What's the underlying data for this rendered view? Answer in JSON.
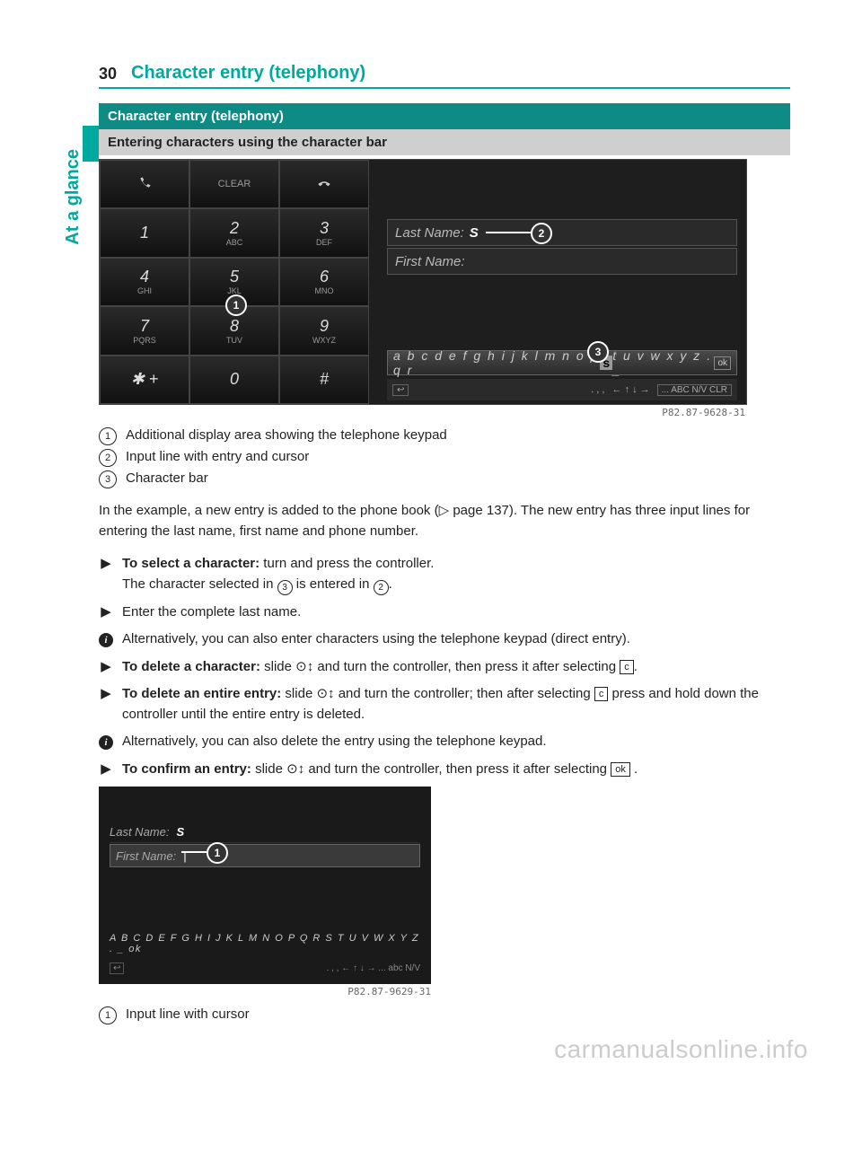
{
  "page": {
    "number": "30",
    "title": "Character entry (telephony)",
    "side_tab": "At a glance"
  },
  "section1": {
    "header": "Character entry (telephony)",
    "sub": "Entering characters using the character bar"
  },
  "fig1": {
    "keys": {
      "clear": "CLEAR",
      "k1": "1",
      "k2": "2",
      "k2s": "ABC",
      "k3": "3",
      "k3s": "DEF",
      "k4": "4",
      "k4s": "GHI",
      "k5": "5",
      "k5s": "JKL",
      "k6": "6",
      "k6s": "MNO",
      "k7": "7",
      "k7s": "PQRS",
      "k8": "8",
      "k8s": "TUV",
      "k9": "9",
      "k9s": "WXYZ",
      "kstar": "✱  +",
      "k0": "0",
      "khash": "#"
    },
    "last_name_label": "Last Name:",
    "last_name_value": "S",
    "first_name_label": "First Name:",
    "charbar_left": "a b c d e f g h i j k l m n o p q r",
    "charbar_hl": "s",
    "charbar_right": "t u v w x y z . _",
    "ok": "ok",
    "bottombar": {
      "dots": ". , ,",
      "arrows": "← ↑ ↓ →",
      "keys": "... ABC N/V CLR"
    },
    "id": "P82.87-9628-31"
  },
  "legend1": {
    "i1": "Additional display area showing the telephone keypad",
    "i2": "Input line with entry and cursor",
    "i3": "Character bar"
  },
  "body": {
    "p1a": "In the example, a new entry is added to the phone book (",
    "p1b": "page 137). The new entry has three input lines for entering the last name, first name and phone number."
  },
  "bullets": {
    "b1a": "To select a character:",
    "b1b": " turn and press the controller.",
    "b1c": "The character selected in ",
    "b1d": " is entered in ",
    "b2": "Enter the complete last name.",
    "b3": "Alternatively, you can also enter characters using the telephone keypad (direct entry).",
    "b4a": "To delete a character:",
    "b4b": " slide ",
    "b4c": " and turn the controller, then press it after selecting ",
    "b5a": "To delete an entire entry:",
    "b5b": " slide ",
    "b5c": " and turn the controller; then after selecting ",
    "b5d": " press and hold down the controller until the entire entry is deleted.",
    "b6": "Alternatively, you can also delete the entry using the telephone keypad.",
    "b7a": "To confirm an entry:",
    "b7b": " slide ",
    "b7c": " and turn the controller, then press it after selecting "
  },
  "fig2": {
    "last_name_label": "Last Name:",
    "last_name_value": "S",
    "first_name_label": "First Name:",
    "first_name_value": "|",
    "charbar": "A B C D E F G H I J K L M N O P Q R S T U V W X Y Z . _ ok",
    "bottom": ". , , ← ↑ ↓ →  ...  abc  N/V",
    "id": "P82.87-9629-31"
  },
  "legend2": {
    "i1": "Input line with cursor"
  },
  "symbols": {
    "triangle": "▶",
    "arrow_right": "▷",
    "slide": "⊙↕",
    "c_key": "c",
    "ok_key": "ok"
  },
  "watermark": "carmanualsonline.info"
}
